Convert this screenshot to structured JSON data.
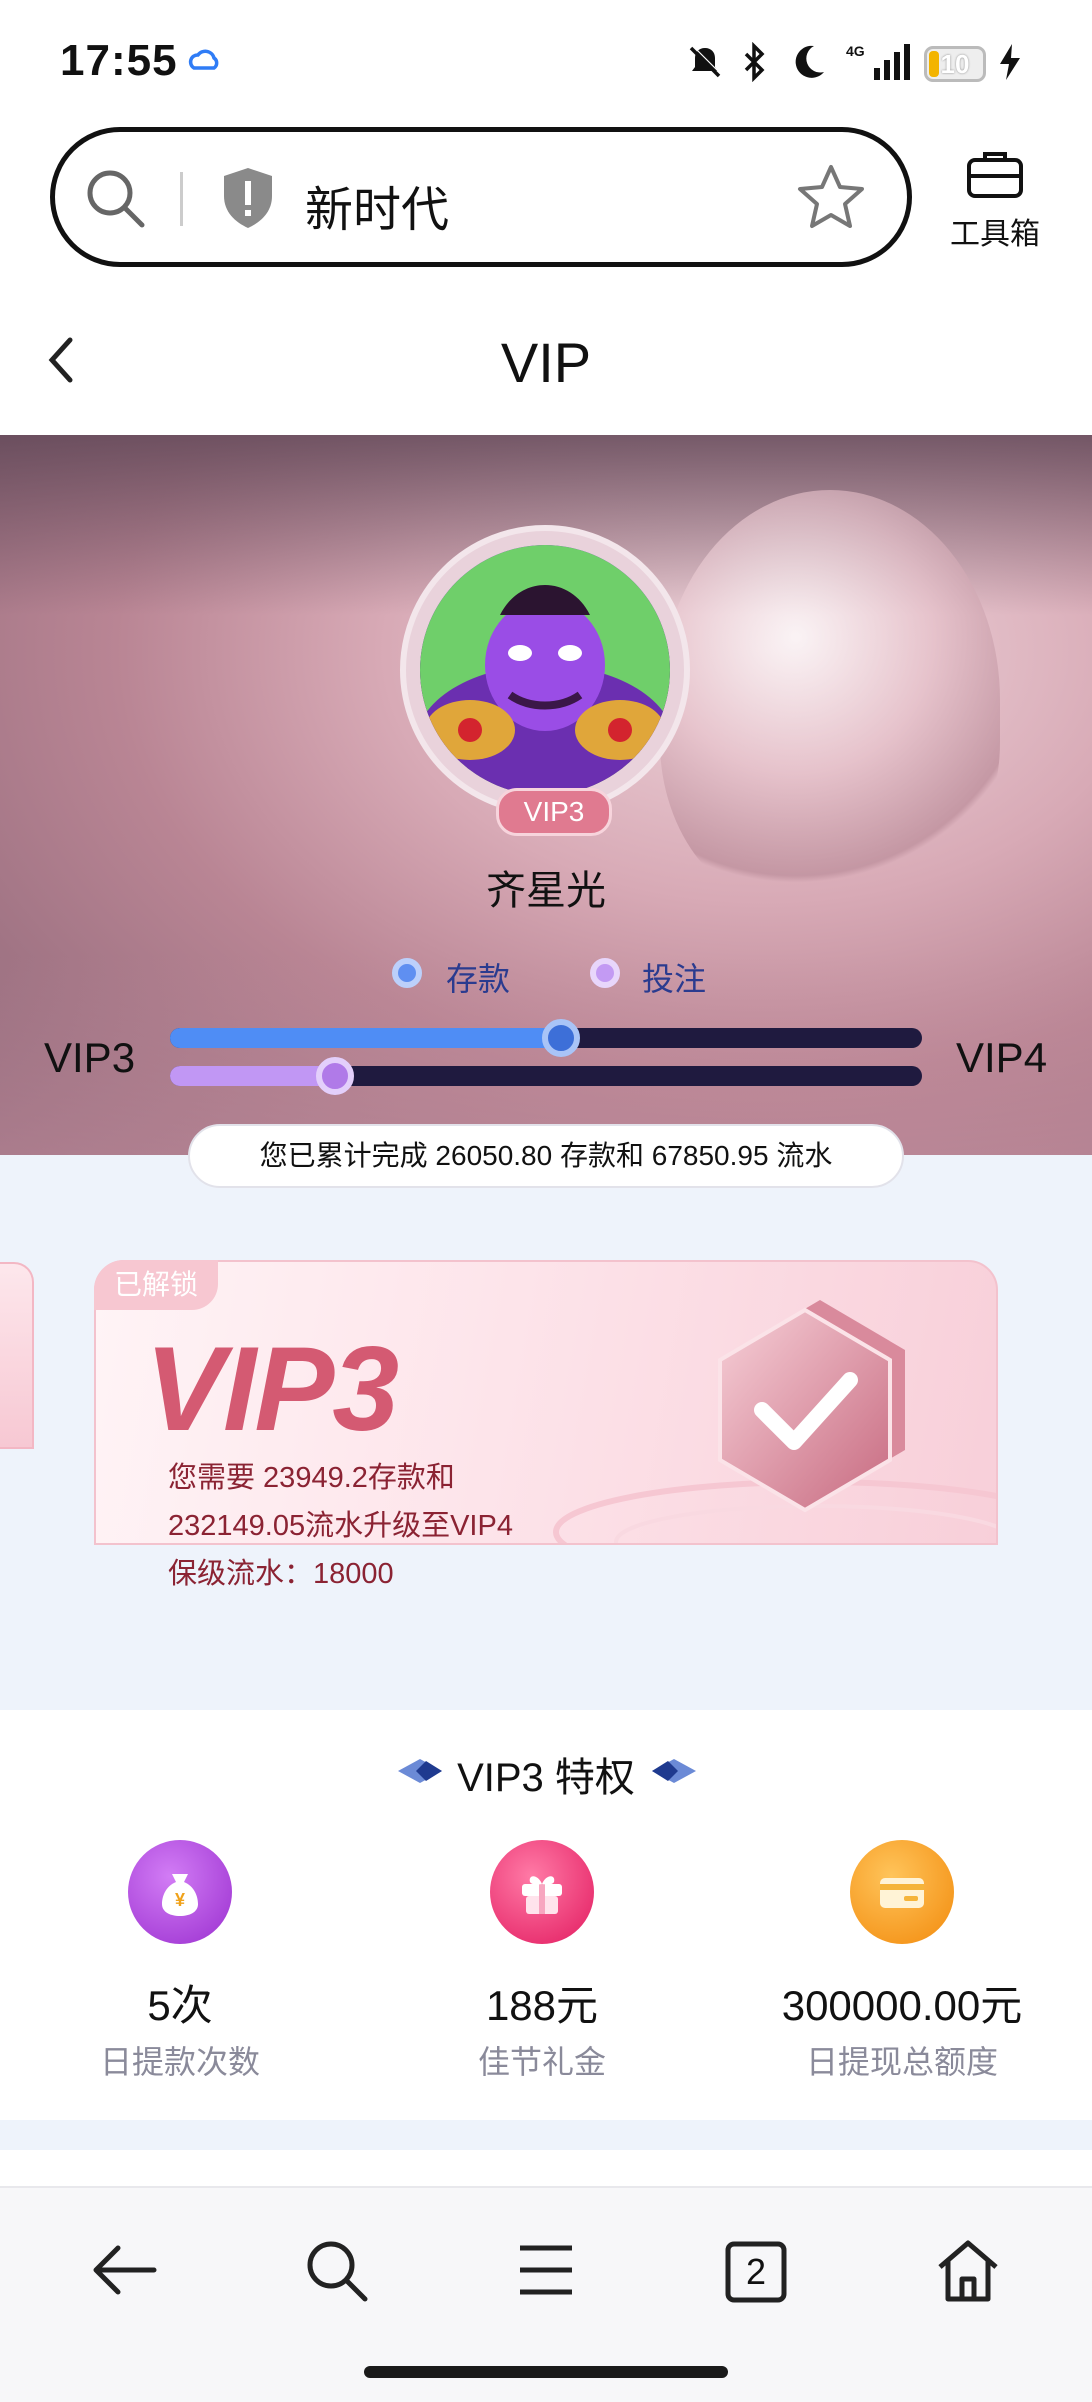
{
  "status_bar": {
    "time": "17:55",
    "network": "4G",
    "battery": "10"
  },
  "address_bar": {
    "url_text": "新时代",
    "toolbox_label": "工具箱"
  },
  "header": {
    "title": "VIP"
  },
  "profile": {
    "badge": "VIP3",
    "username": "齐星光",
    "legend": {
      "deposit": "存款",
      "bet": "投注"
    },
    "current_level": "VIP3",
    "next_level": "VIP4",
    "deposit_progress": 0.52,
    "bet_progress": 0.22,
    "summary": "您已累计完成 26050.80 存款和 67850.95 流水"
  },
  "level_card": {
    "tag": "已解锁",
    "level": "VIP3",
    "line1": "您需要  23949.2存款和",
    "line2": "232149.05流水升级至VIP4",
    "line3": "保级流水：18000"
  },
  "privileges": {
    "title": "VIP3 特权",
    "items": [
      {
        "value": "5次",
        "label": "日提款次数",
        "icon": "money-bag-icon",
        "color": "#b24fe0"
      },
      {
        "value": "188元",
        "label": "佳节礼金",
        "icon": "gift-icon",
        "color": "#ef3f7a"
      },
      {
        "value": "300000.00元",
        "label": "日提现总额度",
        "icon": "card-icon",
        "color": "#f7a01a"
      }
    ]
  },
  "bottom_nav": {
    "tab_count": "2"
  },
  "colors": {
    "accent_blue": "#4f8df5",
    "accent_purple": "#c197f4",
    "vip_pink": "#d45a72"
  }
}
